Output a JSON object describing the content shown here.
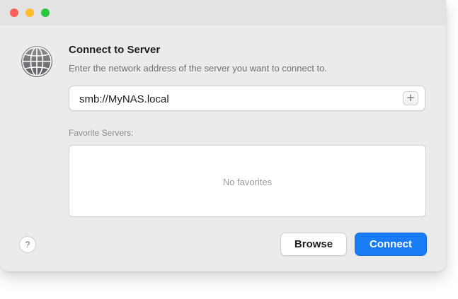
{
  "window": {
    "traffic_lights": {
      "close_color": "#fe5f57",
      "minimize_color": "#febc2e",
      "zoom_color": "#28c840"
    }
  },
  "dialog": {
    "icon": "globe-icon",
    "title": "Connect to Server",
    "subtitle": "Enter the network address of the server you want to connect to."
  },
  "address": {
    "value": "smb://MyNAS.local",
    "add_button_label": "+"
  },
  "favorites": {
    "label": "Favorite Servers:",
    "empty_text": "No favorites",
    "items": []
  },
  "footer": {
    "help_label": "?",
    "browse_label": "Browse",
    "connect_label": "Connect"
  },
  "colors": {
    "accent": "#1a7cf5",
    "window_background": "#ebebeb"
  }
}
